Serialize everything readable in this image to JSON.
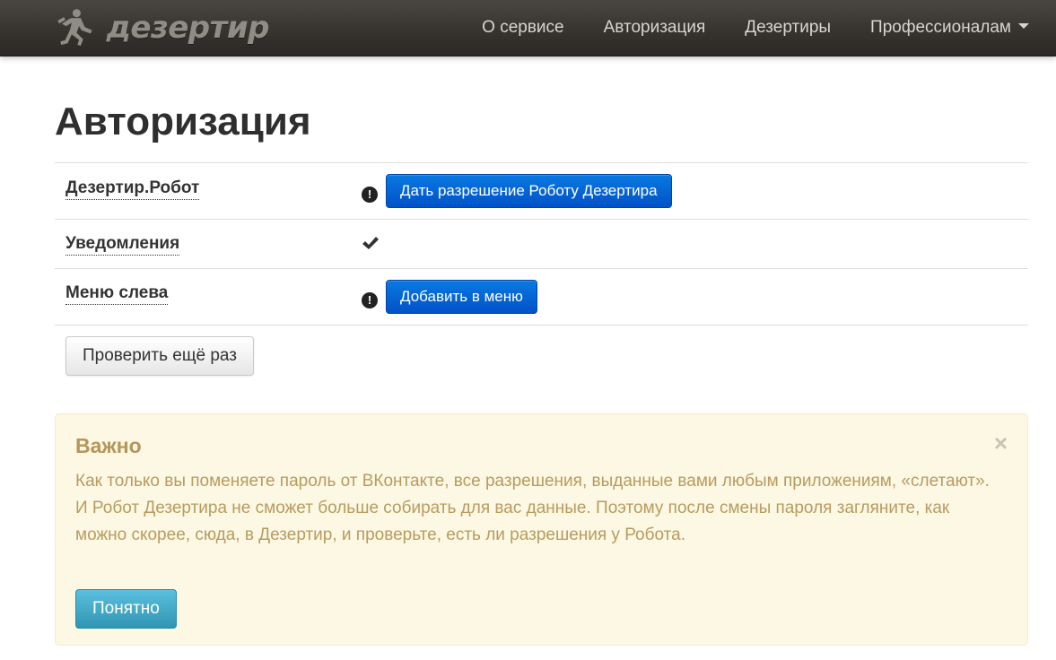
{
  "navbar": {
    "brand_text": "дезертир",
    "items": [
      {
        "label": "О сервисе"
      },
      {
        "label": "Авторизация"
      },
      {
        "label": "Дезертиры"
      },
      {
        "label": "Профессионалам"
      }
    ]
  },
  "page": {
    "title": "Авторизация"
  },
  "auth_rows": [
    {
      "label": "Дезертир.Робот",
      "status": "warning",
      "action_label": "Дать разрешение Роботу Дезертира"
    },
    {
      "label": "Уведомления",
      "status": "ok"
    },
    {
      "label": "Меню слева",
      "status": "warning",
      "action_label": "Добавить в меню"
    }
  ],
  "recheck_label": "Проверить ещё раз",
  "alert": {
    "title": "Важно",
    "close": "×",
    "text": "Как только вы поменяете пароль от ВКонтакте, все разрешения, выданные вами любым приложениям, «слетают». И Робот Дезертира не сможет больше собирать для вас данные. Поэтому после смены пароля загляните, как можно скорее, сюда, в Дезертир, и проверьте, есть ли разрешения у Робота.",
    "ok_label": "Понятно"
  },
  "icons": {
    "warning": "exclamation-circle-icon",
    "ok": "check-icon",
    "logo": "running-man-icon",
    "caret": "caret-down-icon"
  },
  "colors": {
    "primary": "#0064d6",
    "alert_bg": "#fcf8e3",
    "alert_text": "#b89b5f",
    "info_button": "#3fa9cd"
  }
}
